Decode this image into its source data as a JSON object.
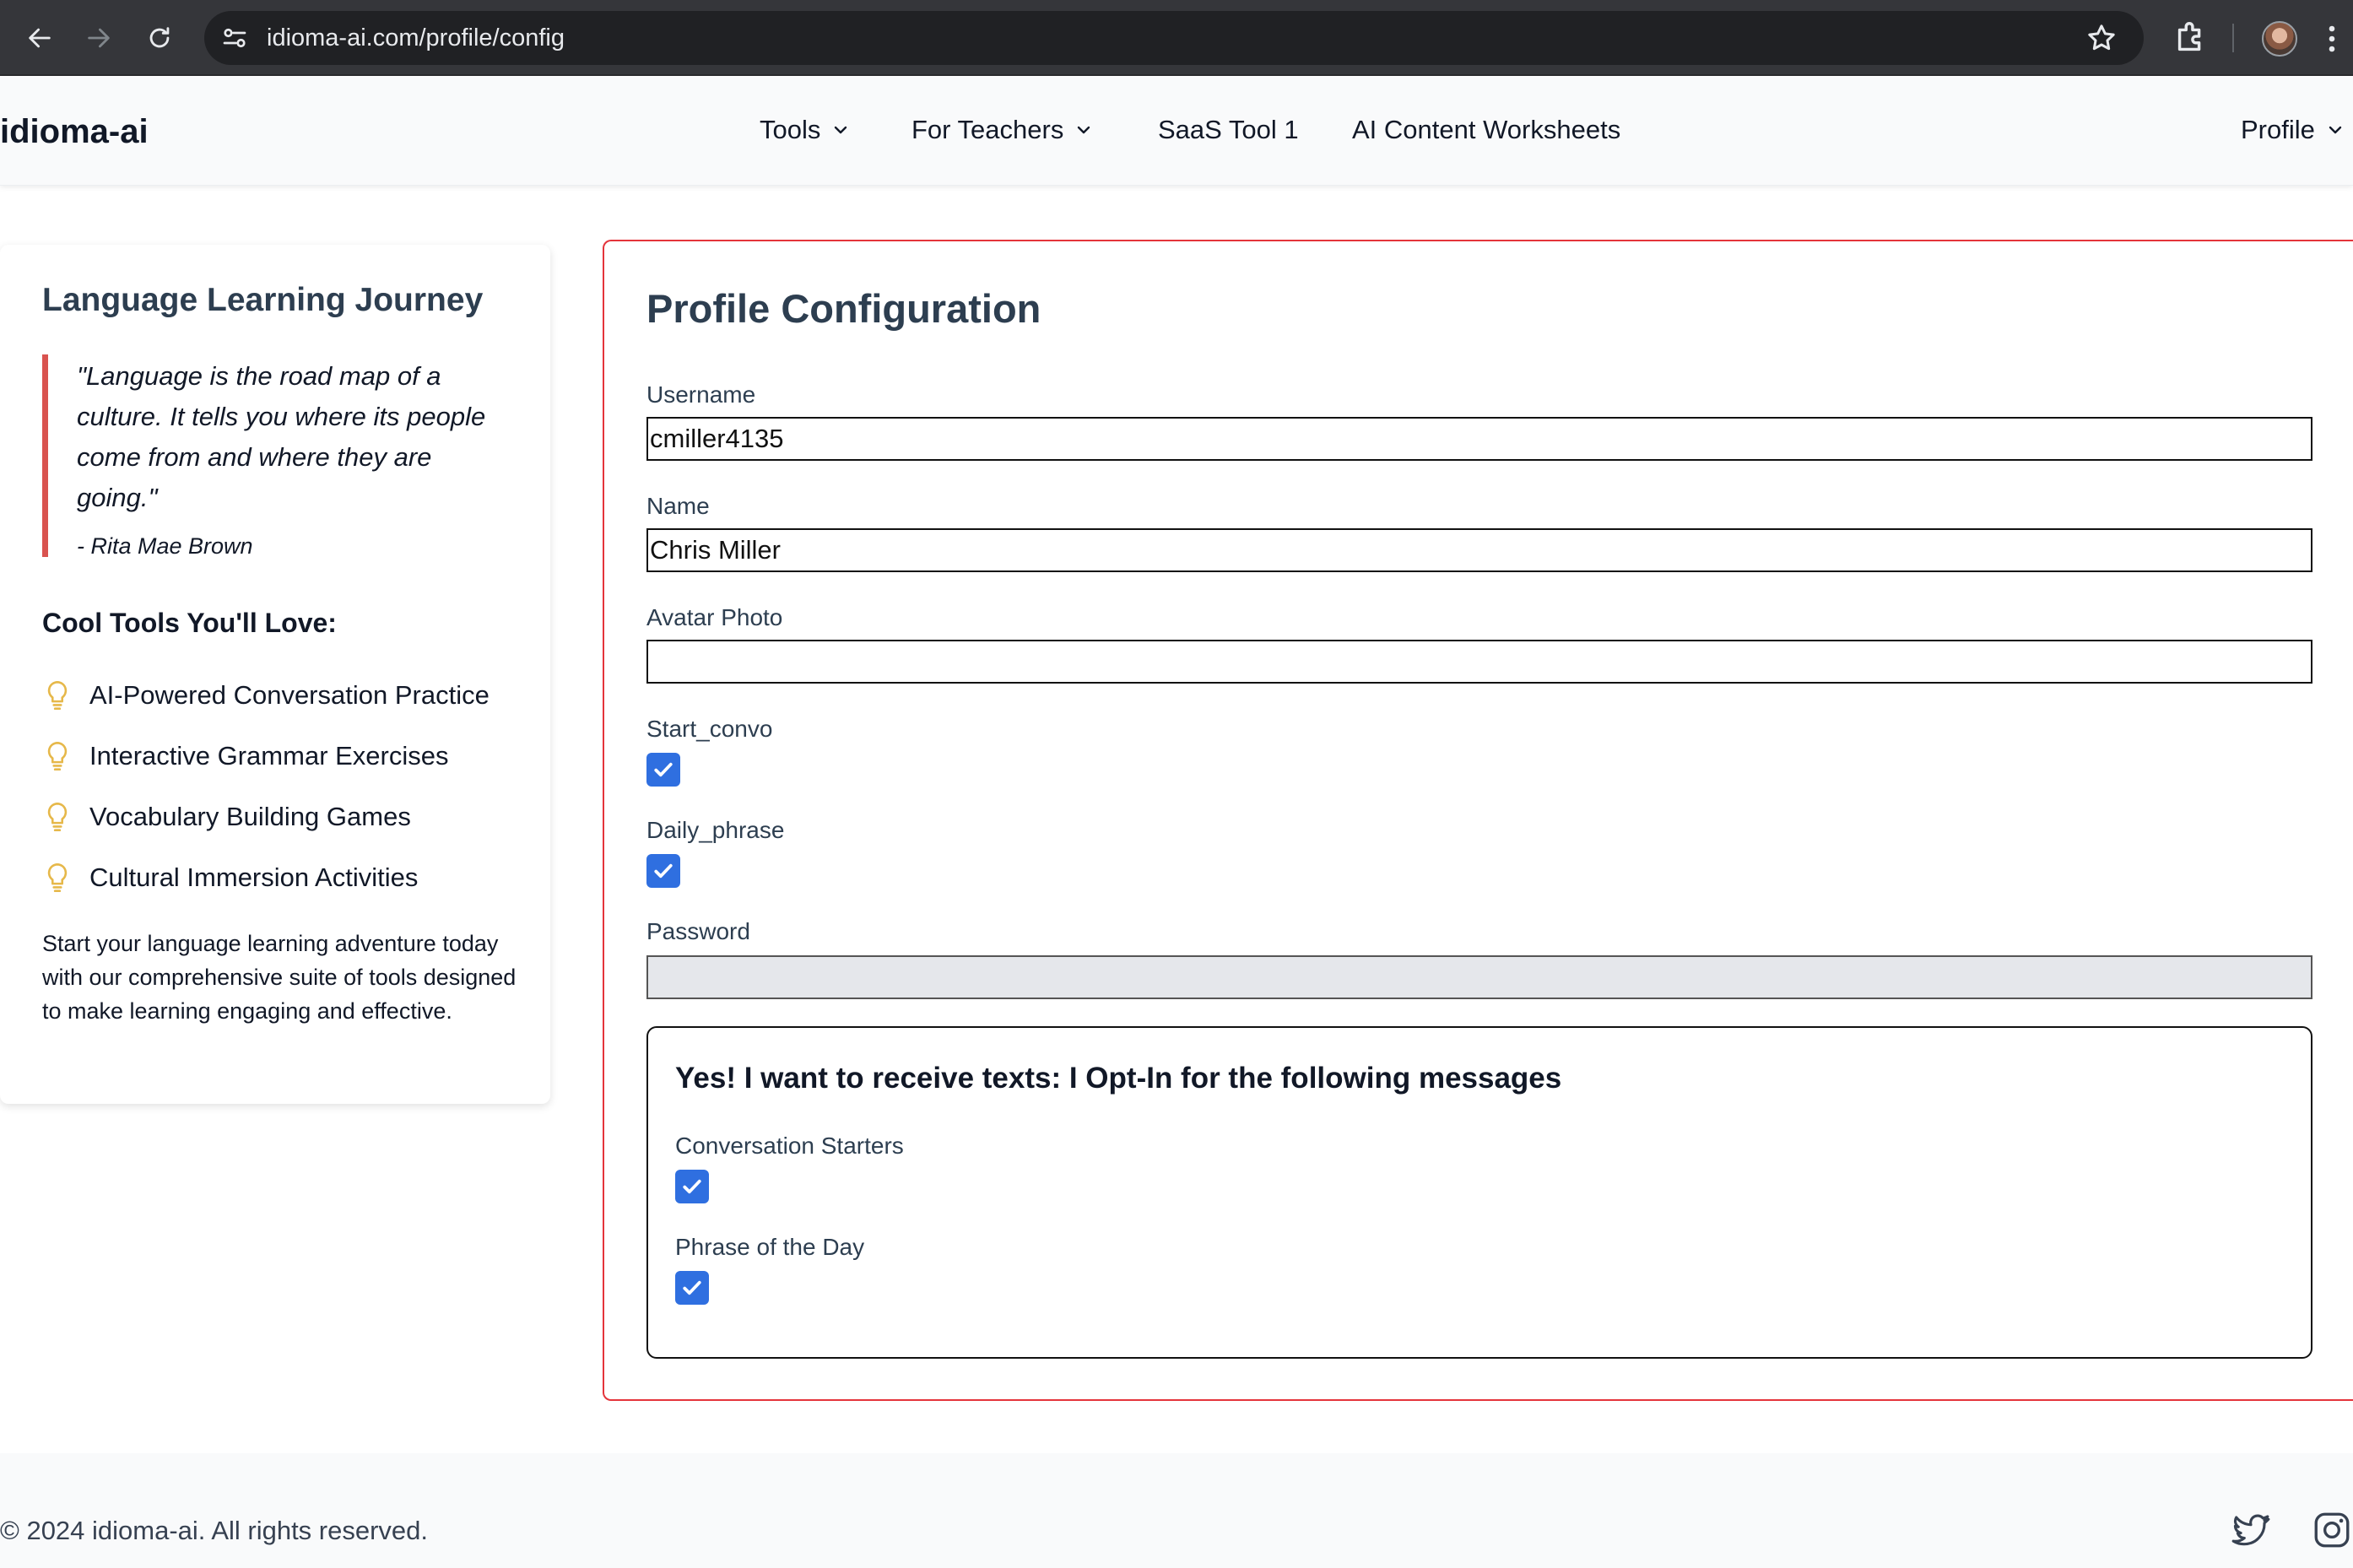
{
  "browser": {
    "url": "idioma-ai.com/profile/config",
    "icons": [
      "back-arrow",
      "forward-arrow",
      "reload",
      "site-settings",
      "bookmark-star",
      "extensions-puzzle",
      "profile-avatar",
      "more-vertical"
    ]
  },
  "header": {
    "brand": "idioma-ai",
    "nav": {
      "tools": "Tools",
      "for_teachers": "For Teachers",
      "saas_tool": "SaaS Tool 1",
      "worksheets": "AI Content Worksheets",
      "profile": "Profile"
    }
  },
  "sidebar": {
    "title": "Language Learning Journey",
    "quote": "\"Language is the road map of a culture. It tells you where its people come from and where they are going.\"",
    "quote_author": "- Rita Mae Brown",
    "cool_tools_title": "Cool Tools You'll Love:",
    "tools": [
      "AI-Powered Conversation Practice",
      "Interactive Grammar Exercises",
      "Vocabulary Building Games",
      "Cultural Immersion Activities"
    ],
    "blurb": "Start your language learning adventure today with our comprehensive suite of tools designed to make learning engaging and effective."
  },
  "form": {
    "title": "Profile Configuration",
    "username_label": "Username",
    "username_value": "cmiller4135",
    "name_label": "Name",
    "name_value": "Chris Miller",
    "avatar_label": "Avatar Photo",
    "avatar_value": "",
    "start_convo_label": "Start_convo",
    "start_convo_checked": true,
    "daily_phrase_label": "Daily_phrase",
    "daily_phrase_checked": true,
    "password_label": "Password",
    "optin": {
      "title": "Yes! I want to receive texts: I Opt-In for the following messages",
      "conversation_starters_label": "Conversation Starters",
      "conversation_starters_checked": true,
      "phrase_of_day_label": "Phrase of the Day",
      "phrase_of_day_checked": true
    }
  },
  "footer": {
    "copyright": "© 2024 idioma-ai. All rights reserved.",
    "social_icons": [
      "twitter-icon",
      "instagram-icon"
    ]
  },
  "colors": {
    "accent_red": "#e4343b",
    "quote_border": "#d9534f",
    "checkbox_blue": "#2f6fe0",
    "heading_slate": "#2d3e50",
    "bulb_gold": "#e6b84a"
  }
}
